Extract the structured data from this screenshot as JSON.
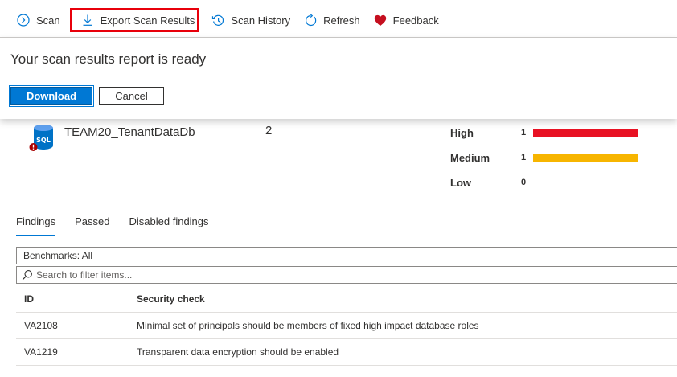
{
  "toolbar": {
    "scan_label": "Scan",
    "export_label": "Export Scan Results",
    "history_label": "Scan History",
    "refresh_label": "Refresh",
    "feedback_label": "Feedback"
  },
  "panel": {
    "title": "Your scan results report is ready",
    "download_label": "Download",
    "cancel_label": "Cancel"
  },
  "database": {
    "name": "TEAM20_TenantDataDb",
    "icon_text": "SQL",
    "failed_count": "2"
  },
  "severity": [
    {
      "label": "High",
      "count": "1",
      "fraction": 1.0,
      "color": "#e81123"
    },
    {
      "label": "Medium",
      "count": "1",
      "fraction": 1.0,
      "color": "#f7b500"
    },
    {
      "label": "Low",
      "count": "0",
      "fraction": 0.0,
      "color": "#ffffff"
    }
  ],
  "tabs": [
    "Findings",
    "Passed",
    "Disabled findings"
  ],
  "filters": {
    "benchmarks": "Benchmarks: All",
    "search_placeholder": "Search to filter items..."
  },
  "table": {
    "headers": {
      "id": "ID",
      "check": "Security check"
    },
    "rows": [
      {
        "id": "VA2108",
        "check": "Minimal set of principals should be members of fixed high impact database roles"
      },
      {
        "id": "VA1219",
        "check": "Transparent data encryption should be enabled"
      }
    ]
  },
  "colors": {
    "accent": "#0078d4",
    "highlight": "#e8000b",
    "high": "#e81123",
    "medium": "#f7b500",
    "feedback_heart": "#c50f1f"
  }
}
